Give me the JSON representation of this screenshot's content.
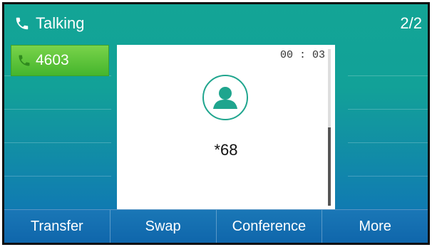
{
  "status_bar": {
    "title": "Talking",
    "page_count": "2/2",
    "icon": "phone-icon"
  },
  "lines": [
    {
      "label": "4603",
      "icon": "phone-icon",
      "active": true
    }
  ],
  "call": {
    "timer": "00 : 03",
    "callee": "*68",
    "avatar_icon": "person-icon"
  },
  "softkeys": [
    "Transfer",
    "Swap",
    "Conference",
    "More"
  ],
  "colors": {
    "accent_green": "#45b52d",
    "avatar_teal": "#1fa58e",
    "bg_teal": "#13a596",
    "bg_blue": "#0f6fb6"
  }
}
